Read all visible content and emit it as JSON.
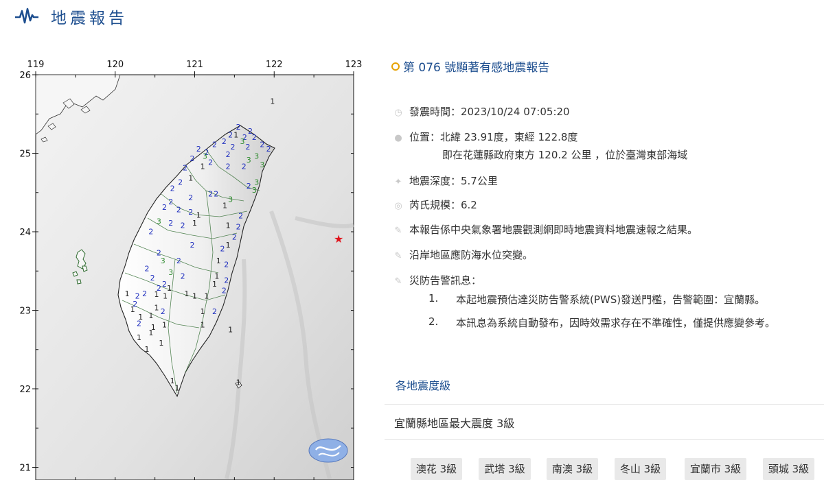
{
  "header": {
    "title": "地震報告",
    "logo_icon": "seismograph-wave-icon"
  },
  "map": {
    "lon_labels": [
      "119",
      "120",
      "121",
      "122",
      "123"
    ],
    "lat_labels": [
      "26",
      "25",
      "24",
      "23",
      "22",
      "21"
    ],
    "epicenter_icon": "epicenter-star-icon",
    "logo_icon": "cwa-logo-icon",
    "intensity_colors": {
      "1": "#222222",
      "2": "#1f2fbf",
      "3": "#2e8b2e"
    },
    "station_marks": [
      {
        "v": "1",
        "lon": 121.98,
        "lat": 25.63
      },
      {
        "v": "2",
        "lon": 121.55,
        "lat": 25.3
      },
      {
        "v": "2",
        "lon": 121.7,
        "lat": 25.25
      },
      {
        "v": "2",
        "lon": 121.45,
        "lat": 25.2
      },
      {
        "v": "2",
        "lon": 121.63,
        "lat": 25.17
      },
      {
        "v": "1",
        "lon": 121.52,
        "lat": 25.2
      },
      {
        "v": "2",
        "lon": 121.75,
        "lat": 25.17
      },
      {
        "v": "3",
        "lon": 121.6,
        "lat": 25.12
      },
      {
        "v": "2",
        "lon": 121.37,
        "lat": 25.12
      },
      {
        "v": "2",
        "lon": 121.25,
        "lat": 25.08
      },
      {
        "v": "2",
        "lon": 121.48,
        "lat": 25.05
      },
      {
        "v": "2",
        "lon": 121.67,
        "lat": 25.05
      },
      {
        "v": "2",
        "lon": 121.85,
        "lat": 25.08
      },
      {
        "v": "2",
        "lon": 121.93,
        "lat": 25.02
      },
      {
        "v": "2",
        "lon": 121.05,
        "lat": 25.02
      },
      {
        "v": "2",
        "lon": 121.15,
        "lat": 24.98
      },
      {
        "v": "2",
        "lon": 121.42,
        "lat": 24.95
      },
      {
        "v": "3",
        "lon": 121.78,
        "lat": 24.93
      },
      {
        "v": "3",
        "lon": 121.68,
        "lat": 24.88
      },
      {
        "v": "3",
        "lon": 121.85,
        "lat": 24.82
      },
      {
        "v": "2",
        "lon": 121.62,
        "lat": 24.8
      },
      {
        "v": "2",
        "lon": 120.97,
        "lat": 24.9
      },
      {
        "v": "2",
        "lon": 121.2,
        "lat": 24.85
      },
      {
        "v": "3",
        "lon": 121.13,
        "lat": 24.93
      },
      {
        "v": "2",
        "lon": 121.42,
        "lat": 24.8
      },
      {
        "v": "1",
        "lon": 121.1,
        "lat": 24.8
      },
      {
        "v": "2",
        "lon": 120.88,
        "lat": 24.78
      },
      {
        "v": "1",
        "lon": 120.95,
        "lat": 24.65
      },
      {
        "v": "3",
        "lon": 121.78,
        "lat": 24.6
      },
      {
        "v": "2",
        "lon": 121.68,
        "lat": 24.55
      },
      {
        "v": "3",
        "lon": 121.75,
        "lat": 24.5
      },
      {
        "v": "2",
        "lon": 120.82,
        "lat": 24.6
      },
      {
        "v": "2",
        "lon": 120.72,
        "lat": 24.52
      },
      {
        "v": "2",
        "lon": 121.2,
        "lat": 24.45
      },
      {
        "v": "2",
        "lon": 121.27,
        "lat": 24.45
      },
      {
        "v": "2",
        "lon": 120.95,
        "lat": 24.4
      },
      {
        "v": "3",
        "lon": 121.45,
        "lat": 24.38
      },
      {
        "v": "2",
        "lon": 120.7,
        "lat": 24.35
      },
      {
        "v": "2",
        "lon": 120.62,
        "lat": 24.28
      },
      {
        "v": "2",
        "lon": 120.8,
        "lat": 24.25
      },
      {
        "v": "1",
        "lon": 121.38,
        "lat": 24.3
      },
      {
        "v": "2",
        "lon": 120.95,
        "lat": 24.22
      },
      {
        "v": "1",
        "lon": 121.05,
        "lat": 24.18
      },
      {
        "v": "2",
        "lon": 121.58,
        "lat": 24.17
      },
      {
        "v": "2",
        "lon": 121.55,
        "lat": 24.03
      },
      {
        "v": "1",
        "lon": 121.42,
        "lat": 24.05
      },
      {
        "v": "3",
        "lon": 120.55,
        "lat": 24.1
      },
      {
        "v": "2",
        "lon": 120.7,
        "lat": 24.08
      },
      {
        "v": "2",
        "lon": 120.85,
        "lat": 24.05
      },
      {
        "v": "1",
        "lon": 121.0,
        "lat": 24.08
      },
      {
        "v": "2",
        "lon": 121.5,
        "lat": 23.9
      },
      {
        "v": "2",
        "lon": 120.45,
        "lat": 23.97
      },
      {
        "v": "1",
        "lon": 121.42,
        "lat": 23.8
      },
      {
        "v": "2",
        "lon": 121.35,
        "lat": 23.75
      },
      {
        "v": "2",
        "lon": 120.97,
        "lat": 23.8
      },
      {
        "v": "2",
        "lon": 120.55,
        "lat": 23.7
      },
      {
        "v": "3",
        "lon": 120.6,
        "lat": 23.6
      },
      {
        "v": "2",
        "lon": 120.8,
        "lat": 23.6
      },
      {
        "v": "1",
        "lon": 121.3,
        "lat": 23.6
      },
      {
        "v": "2",
        "lon": 121.4,
        "lat": 23.55
      },
      {
        "v": "3",
        "lon": 120.7,
        "lat": 23.45
      },
      {
        "v": "2",
        "lon": 120.4,
        "lat": 23.5
      },
      {
        "v": "1",
        "lon": 121.28,
        "lat": 23.4
      },
      {
        "v": "2",
        "lon": 120.85,
        "lat": 23.4
      },
      {
        "v": "2",
        "lon": 120.47,
        "lat": 23.38
      },
      {
        "v": "2",
        "lon": 121.4,
        "lat": 23.35
      },
      {
        "v": "2",
        "lon": 120.62,
        "lat": 23.3
      },
      {
        "v": "1",
        "lon": 120.68,
        "lat": 23.25
      },
      {
        "v": "1",
        "lon": 121.25,
        "lat": 23.3
      },
      {
        "v": "2",
        "lon": 121.37,
        "lat": 23.22
      },
      {
        "v": "2",
        "lon": 120.55,
        "lat": 23.25
      },
      {
        "v": "2",
        "lon": 120.37,
        "lat": 23.18
      },
      {
        "v": "1",
        "lon": 120.15,
        "lat": 23.18
      },
      {
        "v": "2",
        "lon": 120.28,
        "lat": 23.15
      },
      {
        "v": "1",
        "lon": 120.52,
        "lat": 23.17
      },
      {
        "v": "1",
        "lon": 120.63,
        "lat": 23.15
      },
      {
        "v": "1",
        "lon": 120.9,
        "lat": 23.18
      },
      {
        "v": "1",
        "lon": 121.0,
        "lat": 23.15
      },
      {
        "v": "1",
        "lon": 121.15,
        "lat": 23.15
      },
      {
        "v": "2",
        "lon": 120.25,
        "lat": 23.05
      },
      {
        "v": "1",
        "lon": 120.22,
        "lat": 22.98
      },
      {
        "v": "1",
        "lon": 120.52,
        "lat": 23.0
      },
      {
        "v": "2",
        "lon": 120.6,
        "lat": 22.95
      },
      {
        "v": "1",
        "lon": 121.1,
        "lat": 22.95
      },
      {
        "v": "2",
        "lon": 121.25,
        "lat": 22.95
      },
      {
        "v": "1",
        "lon": 120.32,
        "lat": 22.88
      },
      {
        "v": "1",
        "lon": 120.45,
        "lat": 22.9
      },
      {
        "v": "2",
        "lon": 120.3,
        "lat": 22.8
      },
      {
        "v": "1",
        "lon": 120.48,
        "lat": 22.75
      },
      {
        "v": "1",
        "lon": 120.62,
        "lat": 22.78
      },
      {
        "v": "1",
        "lon": 121.1,
        "lat": 22.78
      },
      {
        "v": "1",
        "lon": 121.45,
        "lat": 22.72
      },
      {
        "v": "1",
        "lon": 120.45,
        "lat": 22.68
      },
      {
        "v": "1",
        "lon": 120.3,
        "lat": 22.62
      },
      {
        "v": "1",
        "lon": 120.58,
        "lat": 22.55
      },
      {
        "v": "1",
        "lon": 120.4,
        "lat": 22.47
      },
      {
        "v": "1",
        "lon": 120.72,
        "lat": 22.07
      },
      {
        "v": "1",
        "lon": 120.78,
        "lat": 21.98
      },
      {
        "v": "1",
        "lon": 121.55,
        "lat": 22.05
      }
    ]
  },
  "report": {
    "title": "第 076 號顯著有感地震報告",
    "time_label": "發震時間：2023/10/24 07:05:20",
    "location_label": "位置：北緯 23.91度，東經 122.8度",
    "location_detail": "即在花蓮縣政府東方 120.2 公里 ，位於臺灣東部海域",
    "depth_label": "地震深度：5.7公里",
    "magnitude_label": "芮氏規模：6.2",
    "note1": "本報告係中央氣象署地震觀測網即時地震資料地震速報之結果。",
    "note2": "沿岸地區應防海水位突變。",
    "warn_label": "災防告警訊息：",
    "warn_items": [
      {
        "num": "1.",
        "text": "本起地震預估達災防告警系統(PWS)發送門檻，告警範圍：宜蘭縣。"
      },
      {
        "num": "2.",
        "text": "本訊息為系統自動發布，因時效需求存在不準確性，僅提供應變參考。"
      }
    ],
    "icons": {
      "time": "clock-icon",
      "location": "location-pin-icon",
      "depth": "depth-icon",
      "magnitude": "magnitude-icon",
      "note": "pencil-note-icon"
    }
  },
  "intensity": {
    "section_label": "各地震度級",
    "max_label": "宜蘭縣地區最大震度 3級",
    "stations": [
      {
        "label": "澳花 3級"
      },
      {
        "label": "武塔 3級"
      },
      {
        "label": "南澳 3級"
      },
      {
        "label": "冬山 3級"
      },
      {
        "label": "宜蘭市 3級"
      },
      {
        "label": "頭城 3級"
      }
    ]
  }
}
